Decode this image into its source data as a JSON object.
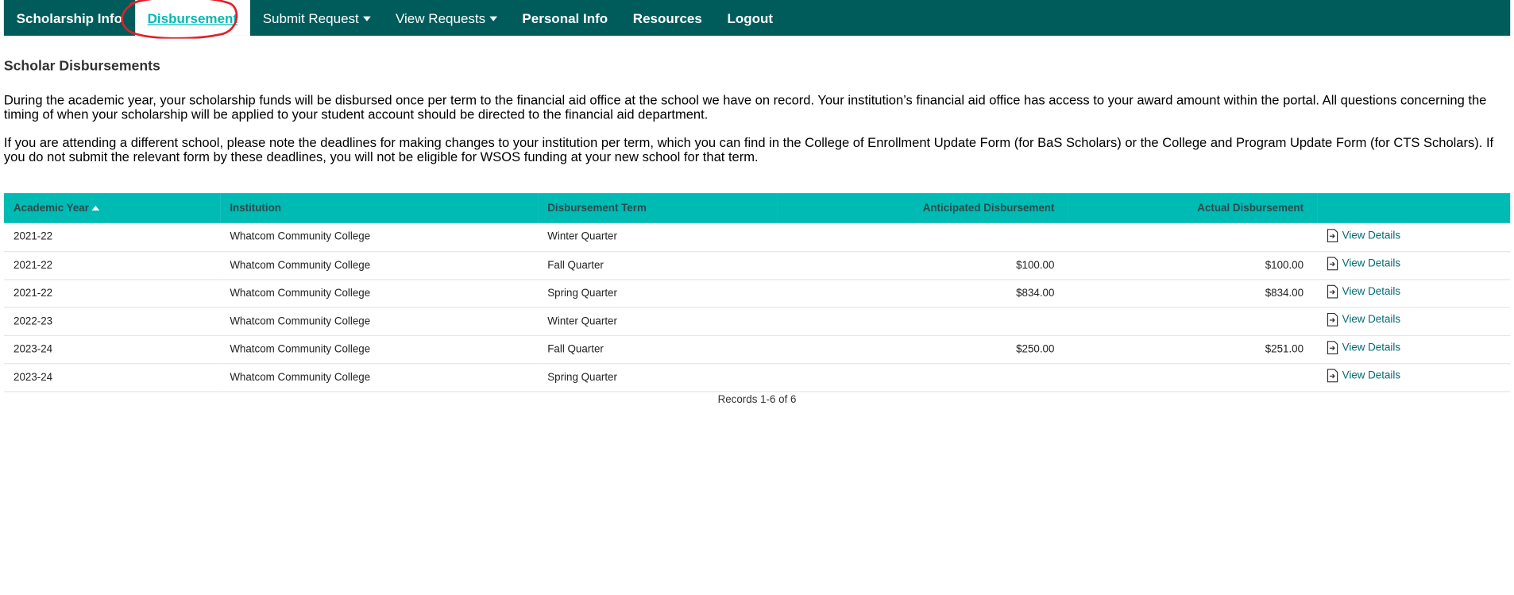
{
  "nav": {
    "items": [
      {
        "label": "Scholarship Info",
        "dropdown": false
      },
      {
        "label": "Disbursement",
        "dropdown": false,
        "active": true
      },
      {
        "label": "Submit Request",
        "dropdown": true
      },
      {
        "label": "View Requests",
        "dropdown": true
      },
      {
        "label": "Personal Info",
        "dropdown": false
      },
      {
        "label": "Resources",
        "dropdown": false
      },
      {
        "label": "Logout",
        "dropdown": false
      }
    ]
  },
  "page": {
    "title": "Scholar Disbursements",
    "paragraph1": "During the academic year, your scholarship funds will be disbursed once per term to the financial aid office at the school we have on record. Your institution’s financial aid office has access to your award amount within the portal. All questions concerning the timing of when your scholarship will be applied to your student account should be directed to the financial aid department.",
    "paragraph2": "If you are attending a different school, please note the deadlines for making changes to your institution per term, which you can find in the College of Enrollment Update Form (for BaS Scholars) or the College and Program Update Form (for CTS Scholars). If you do not submit the relevant form by these deadlines, you will not be eligible for WSOS funding at your new school for that term."
  },
  "table": {
    "headers": {
      "academic_year": "Academic Year",
      "institution": "Institution",
      "term": "Disbursement Term",
      "anticipated": "Anticipated Disbursement",
      "actual": "Actual Disbursement"
    },
    "rows": [
      {
        "year": "2021-22",
        "institution": "Whatcom Community College",
        "term": "Winter Quarter",
        "anticipated": "",
        "actual": "",
        "action": "View Details"
      },
      {
        "year": "2021-22",
        "institution": "Whatcom Community College",
        "term": "Fall Quarter",
        "anticipated": "$100.00",
        "actual": "$100.00",
        "action": "View Details"
      },
      {
        "year": "2021-22",
        "institution": "Whatcom Community College",
        "term": "Spring Quarter",
        "anticipated": "$834.00",
        "actual": "$834.00",
        "action": "View Details"
      },
      {
        "year": "2022-23",
        "institution": "Whatcom Community College",
        "term": "Winter Quarter",
        "anticipated": "",
        "actual": "",
        "action": "View Details"
      },
      {
        "year": "2023-24",
        "institution": "Whatcom Community College",
        "term": "Fall Quarter",
        "anticipated": "$250.00",
        "actual": "$251.00",
        "action": "View Details"
      },
      {
        "year": "2023-24",
        "institution": "Whatcom Community College",
        "term": "Spring Quarter",
        "anticipated": "",
        "actual": "",
        "action": "View Details"
      }
    ],
    "records": "Records 1-6 of 6"
  },
  "colors": {
    "nav_bg": "#005b5b",
    "header_bg": "#00bab4",
    "active_text": "#00bab4",
    "link": "#006a75",
    "annotation": "#e0202a"
  },
  "icons": {
    "sort": "sort-ascending-icon",
    "details": "document-arrow-icon",
    "dropdown": "caret-down-icon"
  }
}
